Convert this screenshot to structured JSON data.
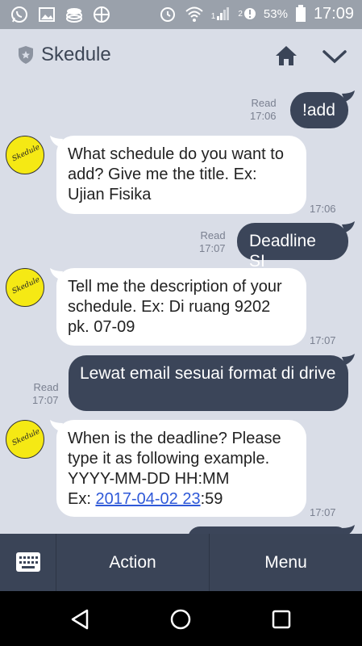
{
  "status_bar": {
    "icons_left": [
      "whatsapp-icon",
      "gallery-icon",
      "storage-icon",
      "browser-icon"
    ],
    "icons_right": [
      "alarm-icon",
      "wifi-icon",
      "signal-icon",
      "data-alert-icon"
    ],
    "signal_label": "1",
    "network_label": "2",
    "battery": "53%",
    "time": "17:09"
  },
  "header": {
    "title": "Skedule"
  },
  "bot": {
    "avatar_text": "Skedule"
  },
  "messages": [
    {
      "direction": "out",
      "text": "!add",
      "read": "Read",
      "time": "17:06"
    },
    {
      "direction": "in",
      "text": "What schedule do you want to add? Give me the title. Ex: Ujian Fisika",
      "time": "17:06"
    },
    {
      "direction": "out",
      "text": "Deadline SI",
      "read": "Read",
      "time": "17:07"
    },
    {
      "direction": "in",
      "text": "Tell me the description of your schedule. Ex: Di ruang 9202 pk. 07-09",
      "time": "17:07"
    },
    {
      "direction": "out",
      "text": "Lewat email sesuai format di drive",
      "read": "Read",
      "time": "17:07"
    },
    {
      "direction": "in",
      "text_lines": [
        "When is the deadline? Please",
        "type it as following example.",
        "YYYY-MM-DD HH:MM"
      ],
      "ex_prefix": "Ex: ",
      "ex_link": "2017-04-02 23",
      "ex_suffix": ":59",
      "time": "17:07"
    }
  ],
  "toolbar": {
    "action_label": "Action",
    "menu_label": "Menu"
  },
  "colors": {
    "background": "#d9dde7",
    "outgoing_bubble": "#3b4559",
    "incoming_bubble": "#ffffff",
    "toolbar": "#3a4457",
    "link": "#2f59d8",
    "avatar": "#f5e914"
  }
}
